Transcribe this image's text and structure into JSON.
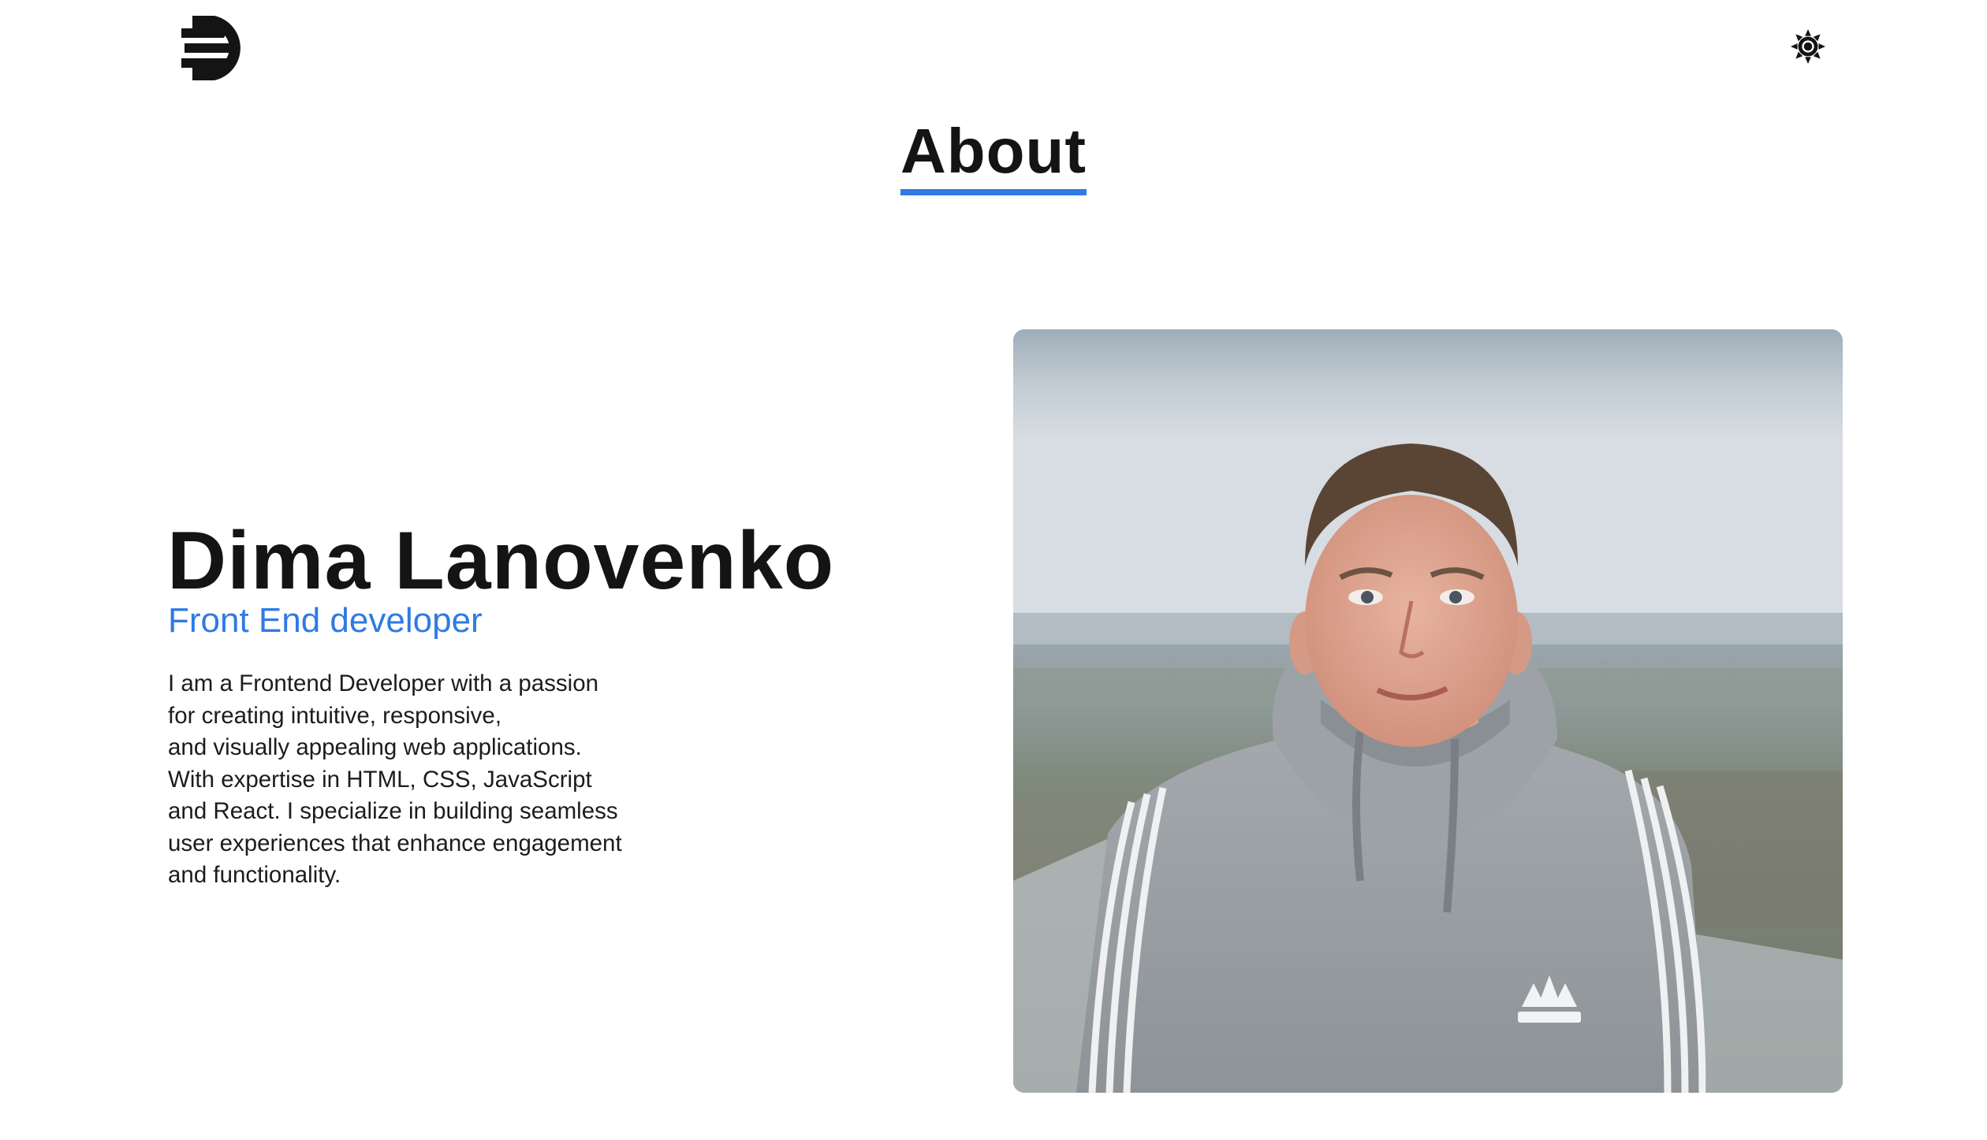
{
  "header": {
    "logo_icon": "db-monogram-logo",
    "theme_toggle_icon": "sun-icon"
  },
  "about": {
    "section_title": "About",
    "name": "Dima Lanovenko",
    "role": "Front End developer",
    "bio_lines": [
      "I am a Frontend Developer with a passion",
      "for creating intuitive, responsive,",
      "and visually appealing web applications.",
      "With expertise in HTML, CSS, JavaScript",
      "and React. I specialize in building seamless",
      "user experiences that enhance engagement",
      "and functionality."
    ],
    "photo": {
      "subject": "portrait-photo",
      "hoodie_logo_text": "adidas"
    }
  },
  "colors": {
    "accent": "#2f7ae5",
    "text": "#141414",
    "background": "#ffffff"
  }
}
